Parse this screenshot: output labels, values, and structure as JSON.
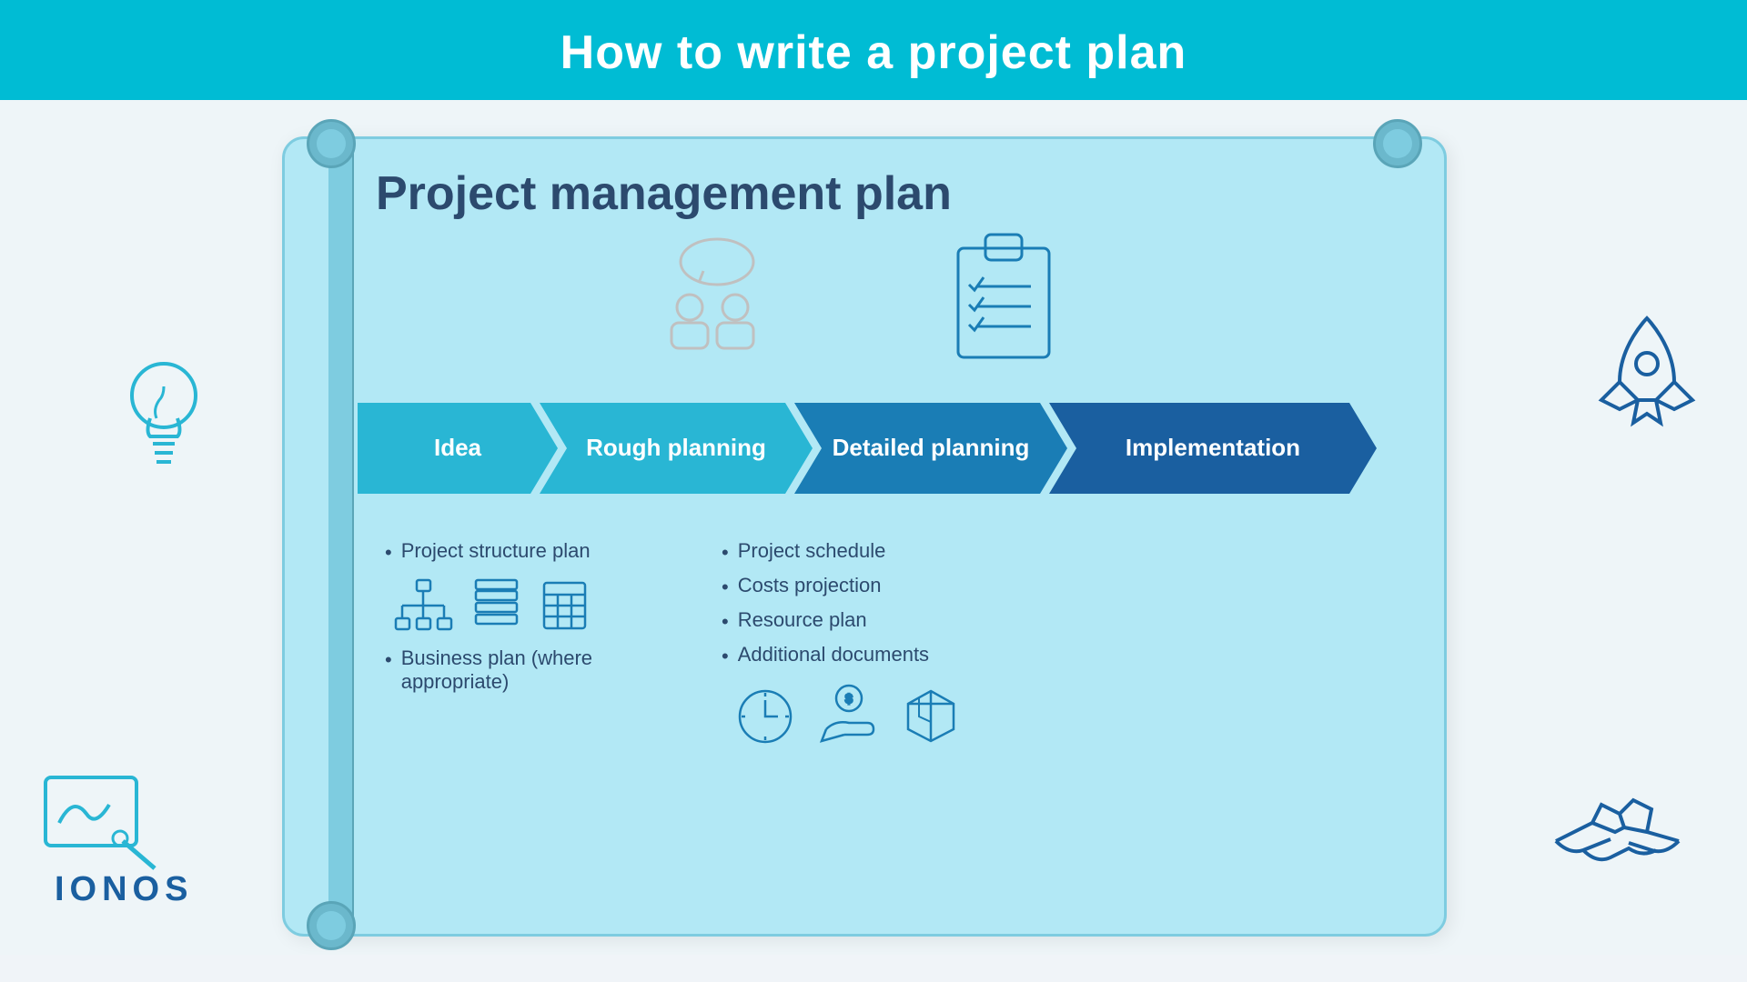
{
  "header": {
    "title": "How to write a project plan"
  },
  "plan": {
    "title": "Project management plan"
  },
  "arrows": [
    {
      "id": "idea",
      "label": "Idea"
    },
    {
      "id": "rough",
      "label": "Rough planning"
    },
    {
      "id": "detailed",
      "label": "Detailed planning"
    },
    {
      "id": "implementation",
      "label": "Implementation"
    }
  ],
  "rough_planning": {
    "items": [
      "Project structure plan",
      "Business plan (where appropriate)"
    ]
  },
  "detailed_planning": {
    "items": [
      "Project schedule",
      "Costs projection",
      "Resource plan",
      "Additional documents"
    ]
  },
  "logo": "IONOS",
  "colors": {
    "teal_light": "#29b6d4",
    "teal_dark": "#00bcd4",
    "blue_mid": "#1a7db5",
    "blue_dark": "#1a5fa0",
    "text_dark": "#2c4a6e",
    "bg_light": "#b2e8f5",
    "white": "#ffffff"
  }
}
